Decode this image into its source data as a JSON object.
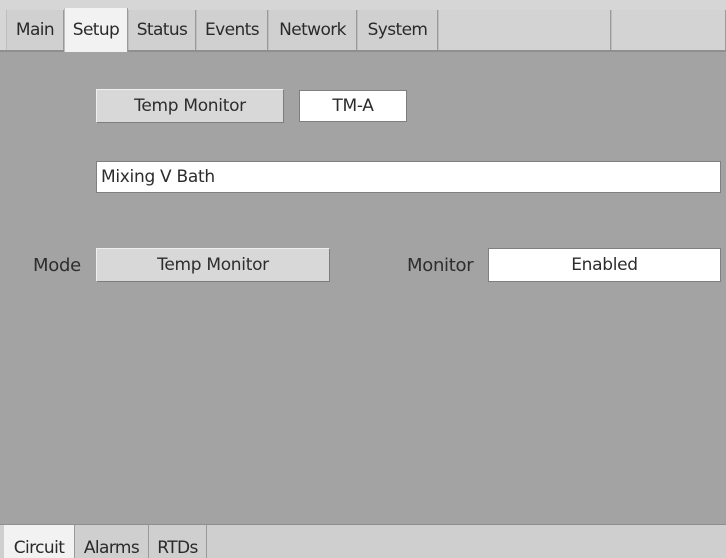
{
  "top_tabs": [
    {
      "label": "Main"
    },
    {
      "label": "Setup",
      "active": true
    },
    {
      "label": "Status"
    },
    {
      "label": "Events"
    },
    {
      "label": "Network"
    },
    {
      "label": "System"
    }
  ],
  "setup": {
    "type_button": "Temp Monitor",
    "tag_value": "TM-A",
    "description_value": "Mixing V Bath",
    "mode_label": "Mode",
    "mode_button": "Temp Monitor",
    "monitor_label": "Monitor",
    "monitor_value": "Enabled"
  },
  "bottom_tabs": [
    {
      "label": "Circuit",
      "active": true
    },
    {
      "label": "Alarms"
    },
    {
      "label": "RTDs"
    }
  ],
  "colors": {
    "panel_background": "#a3a3a3",
    "tab_active": "#f2f2f2",
    "tab_inactive": "#d0d0d0",
    "field_background": "#ffffff"
  }
}
